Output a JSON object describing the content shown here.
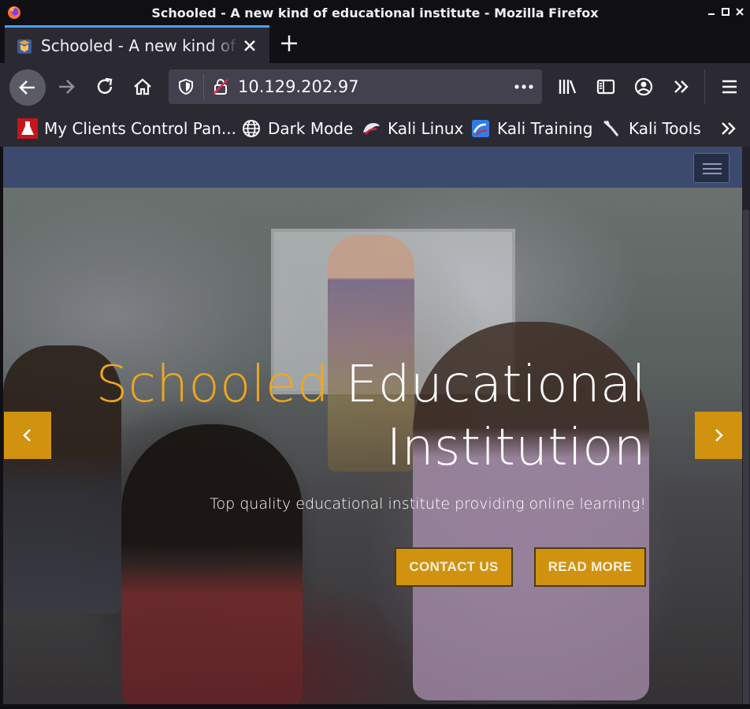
{
  "window": {
    "title": "Schooled - A new kind of educational institute - Mozilla Firefox"
  },
  "tabs": [
    {
      "label": "Schooled - A new kind of educational institute",
      "active": true
    }
  ],
  "navbar": {
    "url": "10.129.202.97"
  },
  "bookmarks": [
    {
      "label": "My Clients Control Pan...",
      "icon": "red-flask-icon"
    },
    {
      "label": "Dark Mode",
      "icon": "globe-icon"
    },
    {
      "label": "Kali Linux",
      "icon": "kali-icon"
    },
    {
      "label": "Kali Training",
      "icon": "kali-training-icon"
    },
    {
      "label": "Kali Tools",
      "icon": "kali-tools-icon"
    }
  ],
  "page": {
    "hero": {
      "title_accent": "Schooled",
      "title_line1_rest": "Educational",
      "title_line2": "Institution",
      "subtitle": "Top quality educational institute providing online learning!",
      "buttons": {
        "contact": "CONTACT US",
        "read_more": "READ MORE"
      }
    }
  },
  "colors": {
    "accent": "#eea720",
    "button_bg": "#d0920f",
    "site_nav_bg": "#3c4a6e",
    "browser_chrome": "#2b2a33",
    "active_tab_indicator": "#4a9fff"
  }
}
